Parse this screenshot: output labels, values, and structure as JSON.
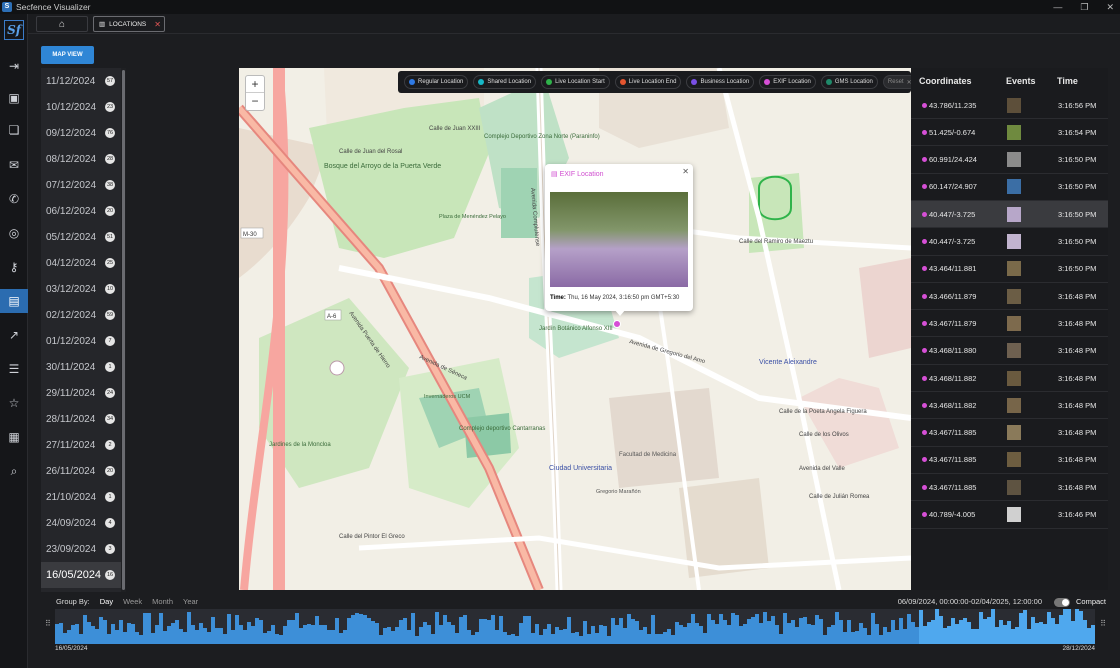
{
  "window": {
    "title": "Secfence Visualizer",
    "brand": "Sf"
  },
  "tabs": {
    "locations": "LOCATIONS"
  },
  "map_view_button": "MAP VIEW",
  "dates": [
    {
      "date": "11/12/2024",
      "count": "57"
    },
    {
      "date": "10/12/2024",
      "count": "23"
    },
    {
      "date": "09/12/2024",
      "count": "76"
    },
    {
      "date": "08/12/2024",
      "count": "28"
    },
    {
      "date": "07/12/2024",
      "count": "38"
    },
    {
      "date": "06/12/2024",
      "count": "20"
    },
    {
      "date": "05/12/2024",
      "count": "51"
    },
    {
      "date": "04/12/2024",
      "count": "25"
    },
    {
      "date": "03/12/2024",
      "count": "10"
    },
    {
      "date": "02/12/2024",
      "count": "59"
    },
    {
      "date": "01/12/2024",
      "count": "7"
    },
    {
      "date": "30/11/2024",
      "count": "1"
    },
    {
      "date": "29/11/2024",
      "count": "24"
    },
    {
      "date": "28/11/2024",
      "count": "34"
    },
    {
      "date": "27/11/2024",
      "count": "2"
    },
    {
      "date": "26/11/2024",
      "count": "20"
    },
    {
      "date": "21/10/2024",
      "count": "1"
    },
    {
      "date": "24/09/2024",
      "count": "4"
    },
    {
      "date": "23/09/2024",
      "count": "3"
    },
    {
      "date": "16/05/2024",
      "count": "16"
    }
  ],
  "legend": [
    {
      "label": "Regular Location",
      "color": "#2f7ae5"
    },
    {
      "label": "Shared Location",
      "color": "#17b8c7"
    },
    {
      "label": "Live Location Start",
      "color": "#2fb34a"
    },
    {
      "label": "Live Location End",
      "color": "#e5552f"
    },
    {
      "label": "Business Location",
      "color": "#7a4fe5"
    },
    {
      "label": "EXIF Location",
      "color": "#d64fd6"
    },
    {
      "label": "GMS Location",
      "color": "#1f8a6a"
    },
    {
      "label": "Reset",
      "color": "#888888"
    }
  ],
  "map": {
    "popup_title": "EXIF Location",
    "popup_time_label": "Time:",
    "popup_time_value": "Thu, 16 May 2024, 3:16:50 pm GMT+5:30",
    "zoom_in": "+",
    "zoom_out": "−",
    "labels": {
      "l1": "Bosque del Arroyo de la Puerta Verde",
      "l2": "Complejo Deportivo Zona Norte (Paraninfo)",
      "l3": "Jardín Botánico Alfonso XIII",
      "l4": "Ciudad Universitaria",
      "l5": "Jardines de la Moncloa",
      "l6": "Vicente Aleixandre",
      "l7": "Facultad de Medicina",
      "l8": "Avenida Puerta de Hierro",
      "l9": "Avenida Complutense",
      "l10": "Complejo deportivo Cantarranas",
      "l11": "Calle del Pintor El Greco",
      "l12": "Avenida de Séneca",
      "l13": "Calle del Ramiro de Maeztu",
      "l14": "Calle de la Poeta Angela Figuera",
      "l15": "Calle de los Olivos",
      "l16": "Avenida del Valle",
      "l17": "Calle de Julián Romea",
      "l18": "Calle de Juan XXIII",
      "l19": "Calle de Juan del Rosal",
      "l20": "M-30",
      "l21": "A-6",
      "l22": "Plaza de Menéndez Pelayo",
      "l23": "Invernaderos UCM",
      "l24": "Gregorio Marañón",
      "l25": "Avenida de Gregorio del Amo"
    }
  },
  "table": {
    "headers": {
      "coordinates": "Coordinates",
      "events": "Events",
      "time": "Time"
    },
    "rows": [
      {
        "coord": "43.786/11.235",
        "time": "3:16:56 PM"
      },
      {
        "coord": "51.425/-0.674",
        "time": "3:16:54 PM"
      },
      {
        "coord": "60.991/24.424",
        "time": "3:16:50 PM"
      },
      {
        "coord": "60.147/24.907",
        "time": "3:16:50 PM"
      },
      {
        "coord": "40.447/-3.725",
        "time": "3:16:50 PM"
      },
      {
        "coord": "40.447/-3.725",
        "time": "3:16:50 PM"
      },
      {
        "coord": "43.464/11.881",
        "time": "3:16:50 PM"
      },
      {
        "coord": "43.466/11.879",
        "time": "3:16:48 PM"
      },
      {
        "coord": "43.467/11.879",
        "time": "3:16:48 PM"
      },
      {
        "coord": "43.468/11.880",
        "time": "3:16:48 PM"
      },
      {
        "coord": "43.468/11.882",
        "time": "3:16:48 PM"
      },
      {
        "coord": "43.468/11.882",
        "time": "3:16:48 PM"
      },
      {
        "coord": "43.467/11.885",
        "time": "3:16:48 PM"
      },
      {
        "coord": "43.467/11.885",
        "time": "3:16:48 PM"
      },
      {
        "coord": "43.467/11.885",
        "time": "3:16:48 PM"
      },
      {
        "coord": "40.789/-4.005",
        "time": "3:16:46 PM"
      }
    ]
  },
  "timeline": {
    "group_by": "Group By:",
    "options": [
      "Day",
      "Week",
      "Month",
      "Year"
    ],
    "range": "06/09/2024, 00:00:00-02/04/2025, 12:00:00",
    "compact": "Compact",
    "start": "16/05/2024",
    "end": "28/12/2024"
  }
}
